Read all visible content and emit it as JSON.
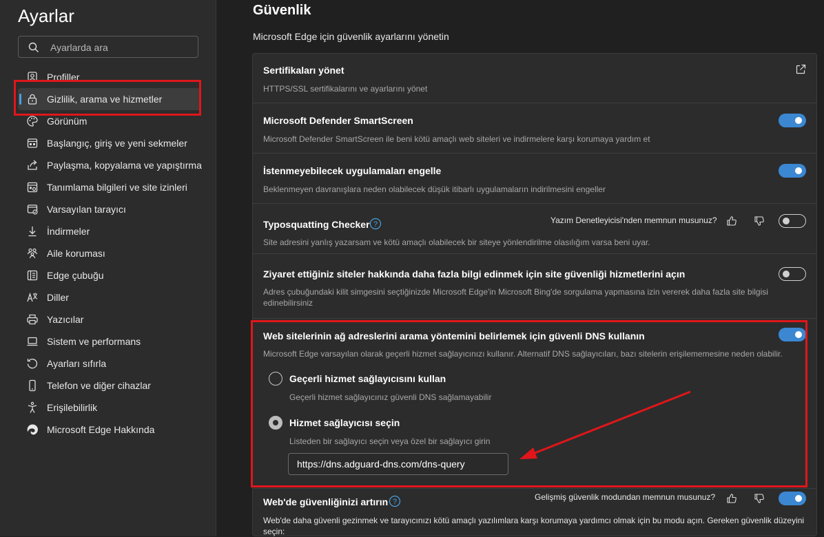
{
  "sidebar": {
    "title": "Ayarlar",
    "search_placeholder": "Ayarlarda ara",
    "items": [
      {
        "label": "Profiller",
        "icon": "profile-icon"
      },
      {
        "label": "Gizlilik, arama ve hizmetler",
        "icon": "lock-icon",
        "active": true
      },
      {
        "label": "Görünüm",
        "icon": "palette-icon"
      },
      {
        "label": "Başlangıç, giriş ve yeni sekmeler",
        "icon": "home-tab-icon"
      },
      {
        "label": "Paylaşma, kopyalama ve yapıştırma",
        "icon": "share-icon"
      },
      {
        "label": "Tanımlama bilgileri ve site izinleri",
        "icon": "site-permissions-icon"
      },
      {
        "label": "Varsayılan tarayıcı",
        "icon": "default-browser-icon"
      },
      {
        "label": "İndirmeler",
        "icon": "download-icon"
      },
      {
        "label": "Aile koruması",
        "icon": "family-icon"
      },
      {
        "label": "Edge çubuğu",
        "icon": "edge-bar-icon"
      },
      {
        "label": "Diller",
        "icon": "language-icon"
      },
      {
        "label": "Yazıcılar",
        "icon": "printer-icon"
      },
      {
        "label": "Sistem ve performans",
        "icon": "system-icon"
      },
      {
        "label": "Ayarları sıfırla",
        "icon": "reset-icon"
      },
      {
        "label": "Telefon ve diğer cihazlar",
        "icon": "phone-icon"
      },
      {
        "label": "Erişilebilirlik",
        "icon": "accessibility-icon"
      },
      {
        "label": "Microsoft Edge Hakkında",
        "icon": "edge-logo-icon"
      }
    ]
  },
  "main": {
    "title": "Güvenlik",
    "subtitle": "Microsoft Edge için güvenlik ayarlarını yönetin",
    "rows": {
      "certs": {
        "title": "Sertifikaları yönet",
        "desc": "HTTPS/SSL sertifikalarını ve ayarlarını yönet"
      },
      "smartscreen": {
        "title": "Microsoft Defender SmartScreen",
        "desc": "Microsoft Defender SmartScreen ile beni kötü amaçlı web siteleri ve indirmelere karşı korumaya yardım et",
        "enabled": true
      },
      "pua": {
        "title": "İstenmeyebilecek uygulamaları engelle",
        "desc": "Beklenmeyen davranışlara neden olabilecek düşük itibarlı uygulamaların indirilmesini engeller",
        "enabled": true
      },
      "typo": {
        "title": "Typosquatting Checker",
        "feedback": "Yazım Denetleyicisi'nden memnun musunuz?",
        "desc": "Site adresini yanlış yazarsam ve kötü amaçlı olabilecek bir siteye yönlendirilme olasılığım varsa beni uyar.",
        "enabled": false
      },
      "visited": {
        "title": "Ziyaret ettiğiniz siteler hakkında daha fazla bilgi edinmek için site güvenliği hizmetlerini açın",
        "desc": "Adres çubuğundaki kilit simgesini seçtiğinizde Microsoft Edge'in Microsoft Bing'de sorgulama yapmasına izin vererek daha fazla site bilgisi edinebilirsiniz",
        "enabled": false
      },
      "dns": {
        "title": "Web sitelerinin ağ adreslerini arama yöntemini belirlemek için güvenli DNS kullanın",
        "desc": "Microsoft Edge varsayılan olarak geçerli hizmet sağlayıcınızı kullanır. Alternatif DNS sağlayıcıları, bazı sitelerin erişilememesine neden olabilir.",
        "enabled": true,
        "option_current": {
          "label": "Geçerli hizmet sağlayıcısını kullan",
          "desc": "Geçerli hizmet sağlayıcınız güvenli DNS sağlamayabilir",
          "selected": false
        },
        "option_choose": {
          "label": "Hizmet sağlayıcısı seçin",
          "desc": "Listeden bir sağlayıcı seçin veya özel bir sağlayıcı girin",
          "selected": true
        },
        "provider_value": "https://dns.adguard-dns.com/dns-query"
      },
      "enhanced": {
        "title": "Web'de güvenliğinizi artırın",
        "feedback": "Gelişmiş güvenlik modundan memnun musunuz?",
        "desc": "Web'de daha güvenli gezinmek ve tarayıcınızı kötü amaçlı yazılımlara karşı korumaya yardımcı olmak için bu modu açın. Gereken güvenlik düzeyini seçin:",
        "enabled": true
      }
    }
  },
  "colors": {
    "accent": "#3b87d2",
    "annotation": "#e0161a",
    "background": "#202020",
    "card": "#2c2c2c"
  }
}
